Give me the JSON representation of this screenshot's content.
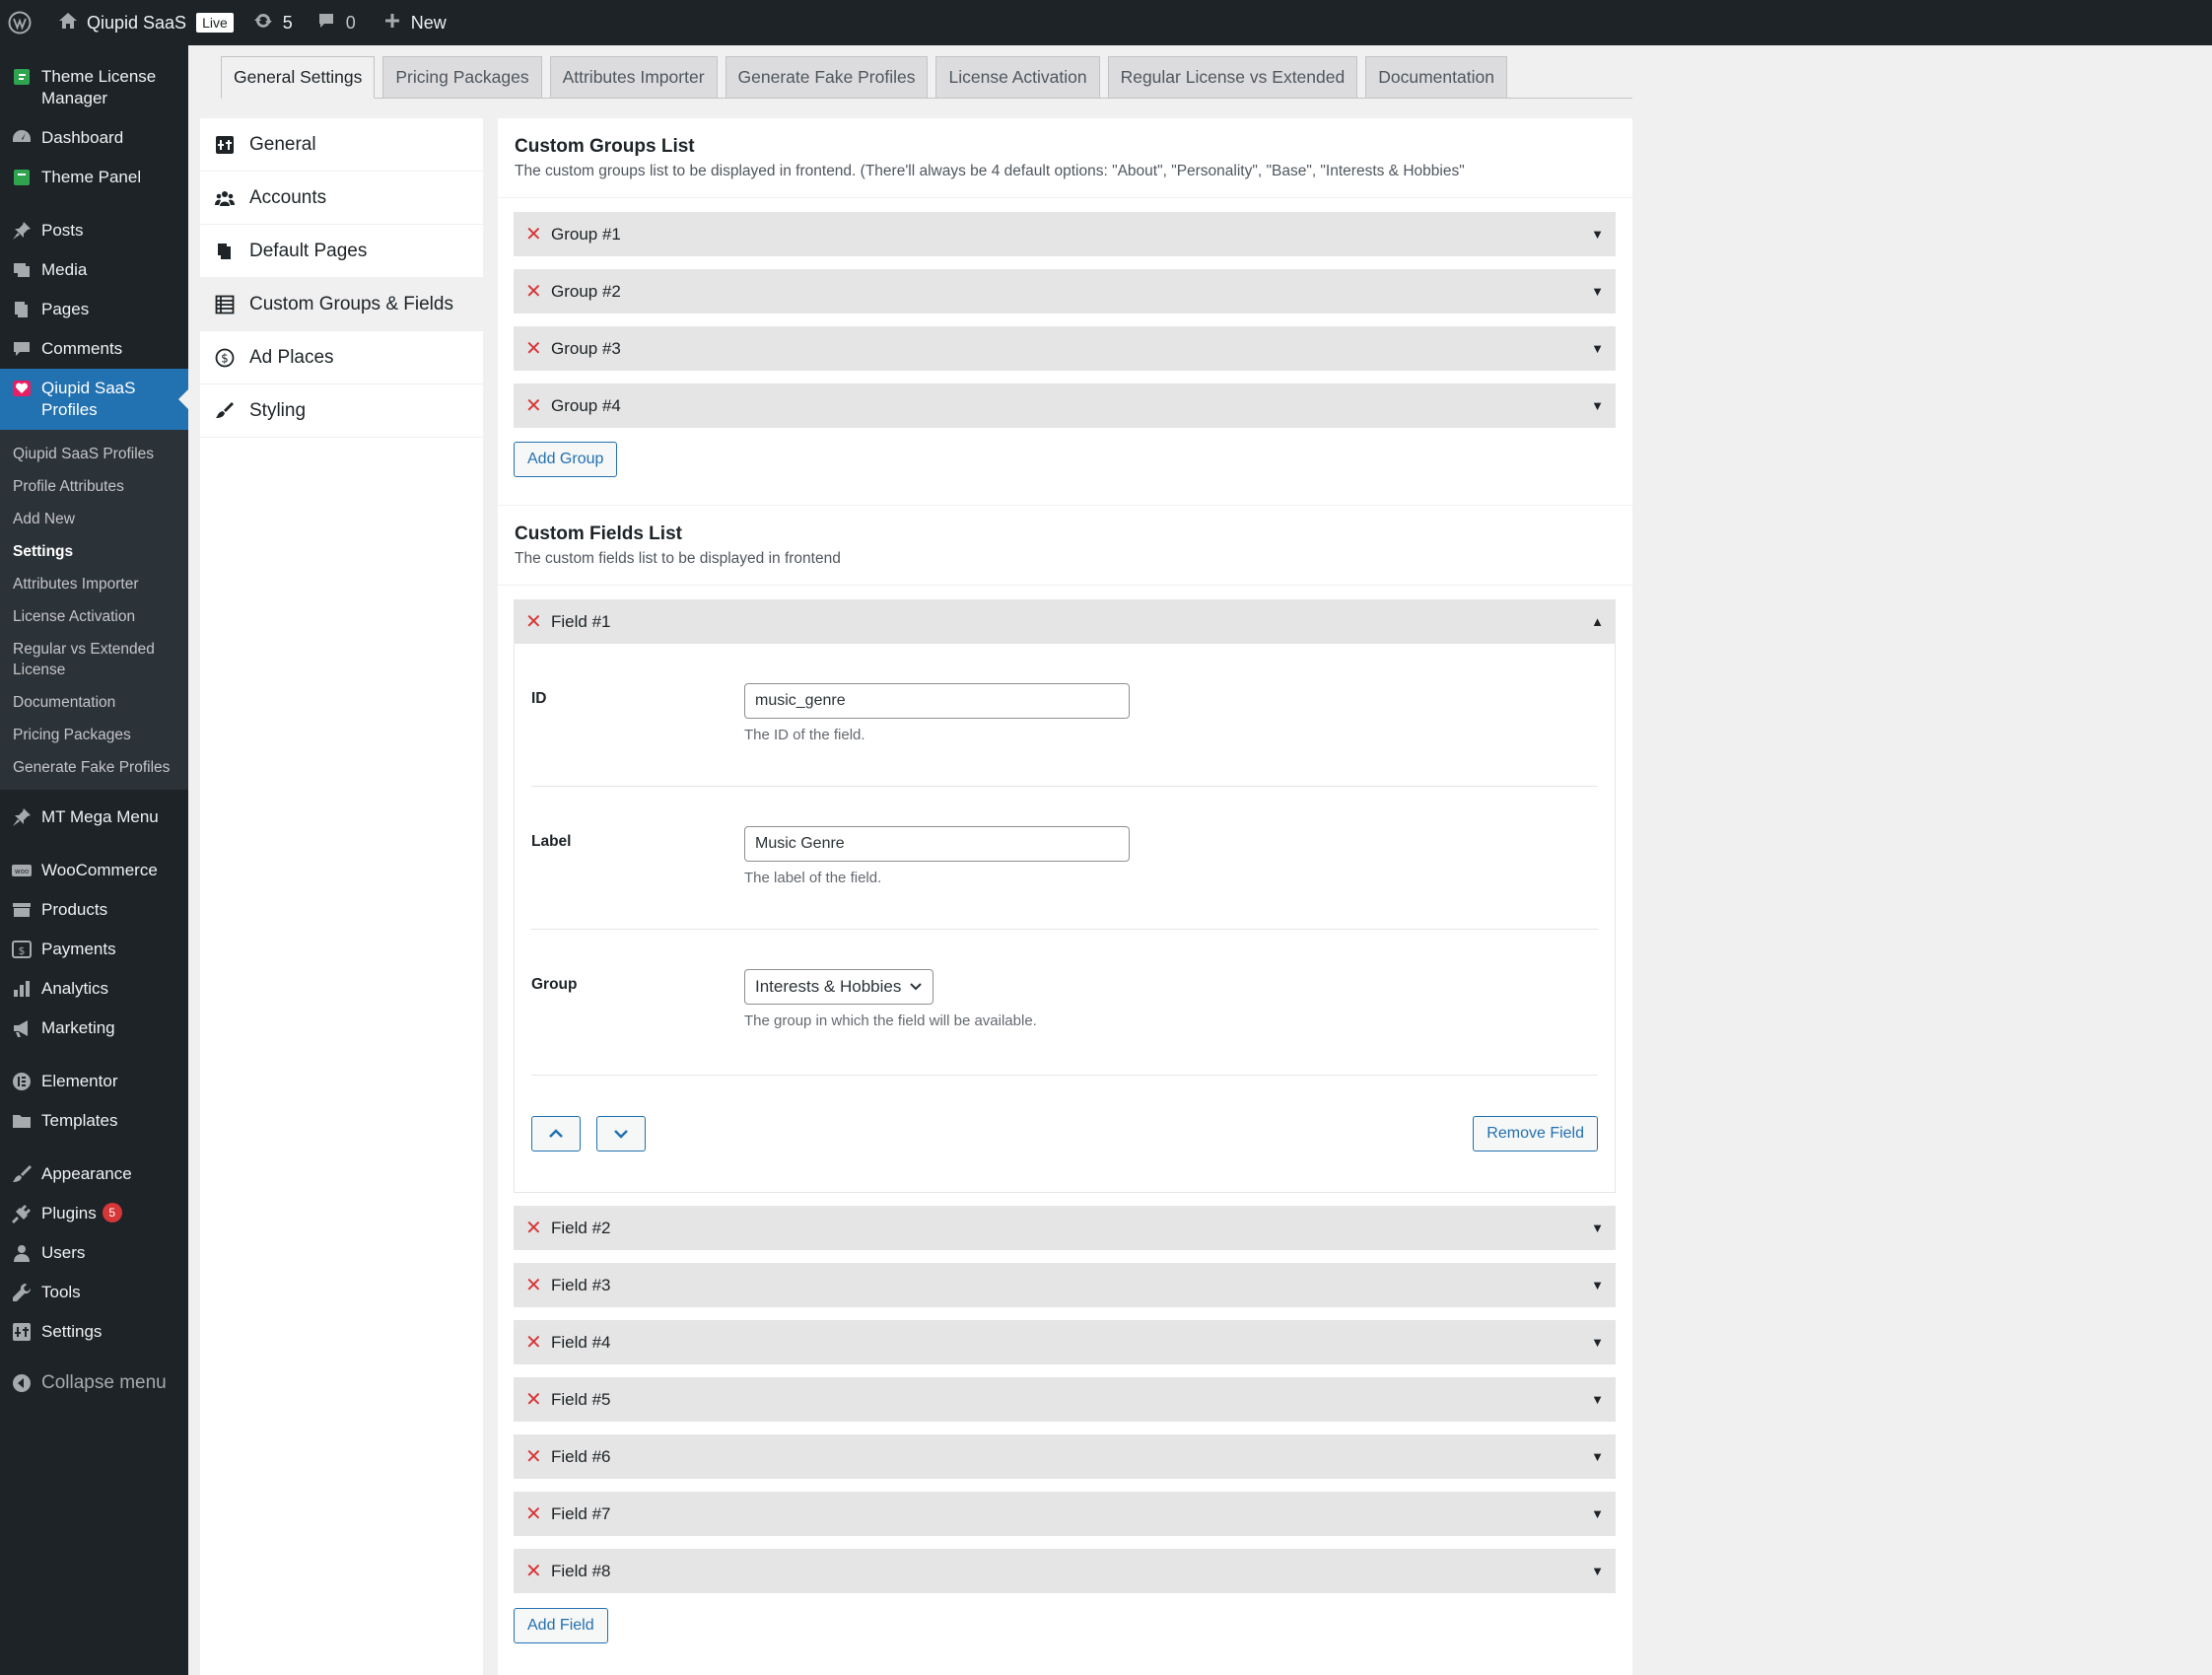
{
  "adminbar": {
    "site_name": "Qiupid SaaS",
    "live_label": "Live",
    "updates_count": "5",
    "comments_count": "0",
    "new_label": "New"
  },
  "menu": {
    "theme_license_manager": "Theme License Manager",
    "dashboard": "Dashboard",
    "theme_panel": "Theme Panel",
    "posts": "Posts",
    "media": "Media",
    "pages": "Pages",
    "comments": "Comments",
    "qiupid_profiles": "Qiupid SaaS Profiles",
    "submenu": [
      "Qiupid SaaS Profiles",
      "Profile Attributes",
      "Add New",
      "Settings",
      "Attributes Importer",
      "License Activation",
      "Regular vs Extended License",
      "Documentation",
      "Pricing Packages",
      "Generate Fake Profiles"
    ],
    "mt_mega_menu": "MT Mega Menu",
    "woocommerce": "WooCommerce",
    "products": "Products",
    "payments": "Payments",
    "analytics": "Analytics",
    "marketing": "Marketing",
    "elementor": "Elementor",
    "templates": "Templates",
    "appearance": "Appearance",
    "plugins": "Plugins",
    "plugins_badge": "5",
    "users": "Users",
    "tools": "Tools",
    "settings": "Settings",
    "collapse": "Collapse menu"
  },
  "tabs": [
    "General Settings",
    "Pricing Packages",
    "Attributes Importer",
    "Generate Fake Profiles",
    "License Activation",
    "Regular License vs Extended",
    "Documentation"
  ],
  "settings_nav": [
    "General",
    "Accounts",
    "Default Pages",
    "Custom Groups & Fields",
    "Ad Places",
    "Styling"
  ],
  "groups": {
    "title": "Custom Groups List",
    "desc": "The custom groups list to be displayed in frontend. (There'll always be 4 default options: \"About\", \"Personality\", \"Base\", \"Interests & Hobbies\"",
    "items": [
      "Group #1",
      "Group #2",
      "Group #3",
      "Group #4"
    ],
    "add_label": "Add Group"
  },
  "fields": {
    "title": "Custom Fields List",
    "desc": "The custom fields list to be displayed in frontend",
    "open_item": "Field #1",
    "id_label": "ID",
    "id_value": "music_genre",
    "id_help": "The ID of the field.",
    "label_label": "Label",
    "label_value": "Music Genre",
    "label_help": "The label of the field.",
    "group_label": "Group",
    "group_value": "Interests & Hobbies",
    "group_help": "The group in which the field will be available.",
    "remove_label": "Remove Field",
    "items": [
      "Field #2",
      "Field #3",
      "Field #4",
      "Field #5",
      "Field #6",
      "Field #7",
      "Field #8"
    ],
    "add_label": "Add Field"
  },
  "colors": {
    "adminbar_bg": "#1d2327",
    "accent": "#2271b1",
    "danger": "#d63638"
  }
}
